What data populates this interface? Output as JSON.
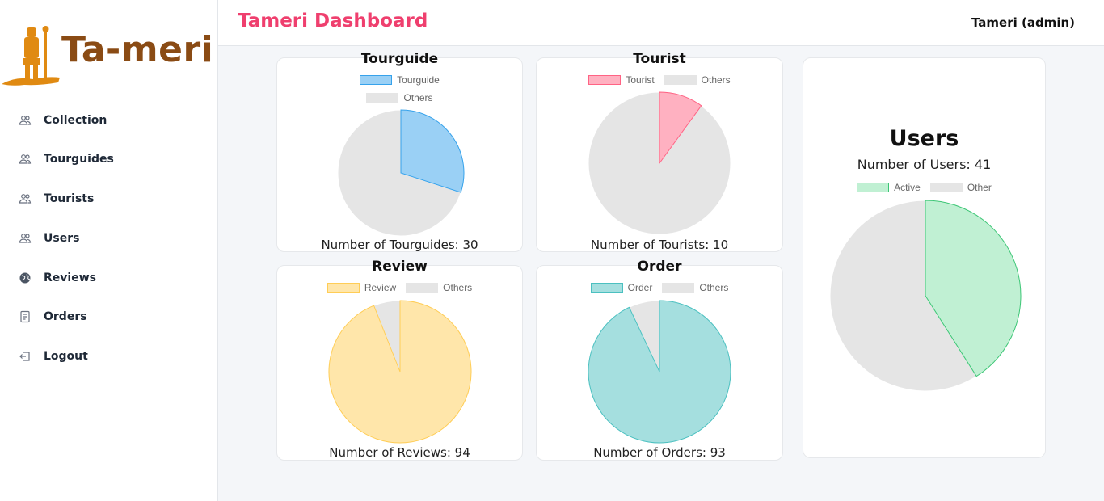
{
  "brand": {
    "logo_text": "Ta-meri"
  },
  "header": {
    "title": "Tameri Dashboard",
    "user": "Tameri (admin)"
  },
  "sidebar": {
    "items": [
      {
        "label": "Collection",
        "icon": "users-icon"
      },
      {
        "label": "Tourguides",
        "icon": "users-icon"
      },
      {
        "label": "Tourists",
        "icon": "users-icon"
      },
      {
        "label": "Users",
        "icon": "users-icon"
      },
      {
        "label": "Reviews",
        "icon": "globe-icon"
      },
      {
        "label": "Orders",
        "icon": "document-icon"
      },
      {
        "label": "Logout",
        "icon": "logout-icon"
      }
    ]
  },
  "colors": {
    "title": "#ef3f6e",
    "tourguide_fill": "#9ad0f5",
    "tourguide_stroke": "#36a2eb",
    "tourist_fill": "#ffb1c1",
    "tourist_stroke": "#ff6384",
    "review_fill": "#ffe6aa",
    "review_stroke": "#ffcd56",
    "order_fill": "#a5dfdf",
    "order_stroke": "#4bc0c0",
    "active_fill": "#c0f0d3",
    "active_stroke": "#3cc675",
    "other_fill": "#e5e5e5"
  },
  "cards": {
    "tourguide": {
      "title": "Tourguide",
      "legend": [
        "Tourguide",
        "Others"
      ],
      "footer": "Number of Tourguides: 30"
    },
    "tourist": {
      "title": "Tourist",
      "legend": [
        "Tourist",
        "Others"
      ],
      "footer": "Number of Tourists: 10"
    },
    "review": {
      "title": "Review",
      "legend": [
        "Review",
        "Others"
      ],
      "footer": "Number of Reviews: 94"
    },
    "order": {
      "title": "Order",
      "legend": [
        "Order",
        "Others"
      ],
      "footer": "Number of Orders: 93"
    },
    "users": {
      "title": "Users",
      "subtitle": "Number of Users: 41",
      "legend": [
        "Active",
        "Other"
      ]
    }
  },
  "chart_data": [
    {
      "type": "pie",
      "title": "Tourguide",
      "categories": [
        "Tourguide",
        "Others"
      ],
      "values": [
        30,
        70
      ]
    },
    {
      "type": "pie",
      "title": "Tourist",
      "categories": [
        "Tourist",
        "Others"
      ],
      "values": [
        10,
        90
      ]
    },
    {
      "type": "pie",
      "title": "Review",
      "categories": [
        "Review",
        "Others"
      ],
      "values": [
        94,
        6
      ]
    },
    {
      "type": "pie",
      "title": "Order",
      "categories": [
        "Order",
        "Others"
      ],
      "values": [
        93,
        7
      ]
    },
    {
      "type": "pie",
      "title": "Users",
      "categories": [
        "Active",
        "Other"
      ],
      "values": [
        41,
        59
      ]
    }
  ]
}
